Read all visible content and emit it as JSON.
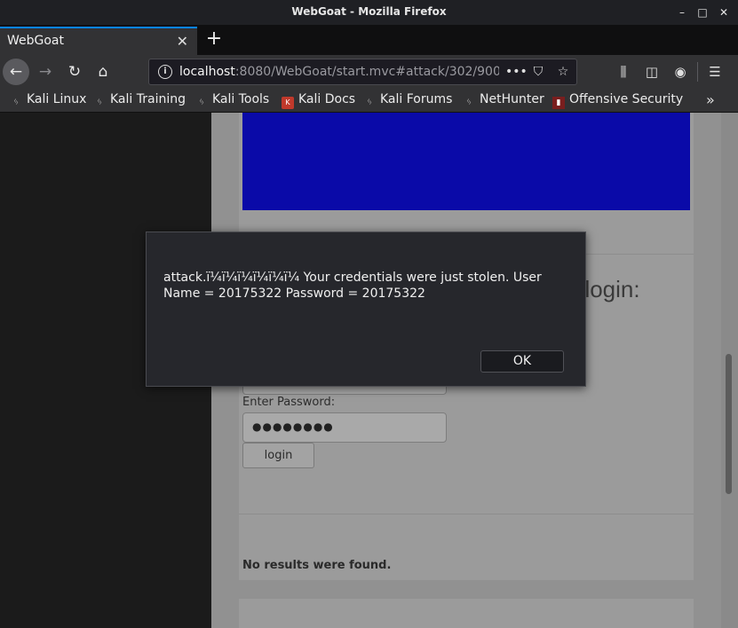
{
  "window": {
    "title": "WebGoat - Mozilla Firefox",
    "minimize_glyph": "–",
    "maximize_glyph": "□",
    "close_glyph": "✕"
  },
  "tabs": [
    {
      "label": "WebGoat",
      "active": true
    }
  ],
  "nav": {
    "url_host": "localhost",
    "url_path": ":8080/WebGoat/start.mvc#attack/302/9",
    "url_overflow": "00",
    "icons": [
      "back-icon",
      "forward-icon",
      "reload-icon",
      "home-icon",
      "site-info-icon",
      "page-actions-icon",
      "pocket-icon",
      "bookmark-star-icon",
      "library-icon",
      "sidebar-icon",
      "account-icon",
      "menu-icon"
    ]
  },
  "bookmarks": [
    {
      "label": "Kali Linux",
      "icon": "kali-dragon-icon"
    },
    {
      "label": "Kali Training",
      "icon": "kali-dragon-icon"
    },
    {
      "label": "Kali Tools",
      "icon": "kali-dragon-icon"
    },
    {
      "label": "Kali Docs",
      "icon": "kali-docs-icon"
    },
    {
      "label": "Kali Forums",
      "icon": "kali-dragon-icon"
    },
    {
      "label": "NetHunter",
      "icon": "kali-dragon-icon"
    },
    {
      "label": "Offensive Security",
      "icon": "offsec-icon"
    }
  ],
  "page": {
    "login_heading": "t login:",
    "password_label": "Enter Password:",
    "password_value": "●●●●●●●●",
    "login_button": "login",
    "no_results": "No results were found."
  },
  "dialog": {
    "message": "attack.ï¼ï¼ï¼ï¼ï¼ï¼ Your credentials were just stolen. User Name = 20175322 Password = 20175322",
    "ok_label": "OK"
  },
  "colors": {
    "banner": "#0a0aa8",
    "tab_accent": "#0a84ff",
    "dialog_bg": "#26272c"
  }
}
